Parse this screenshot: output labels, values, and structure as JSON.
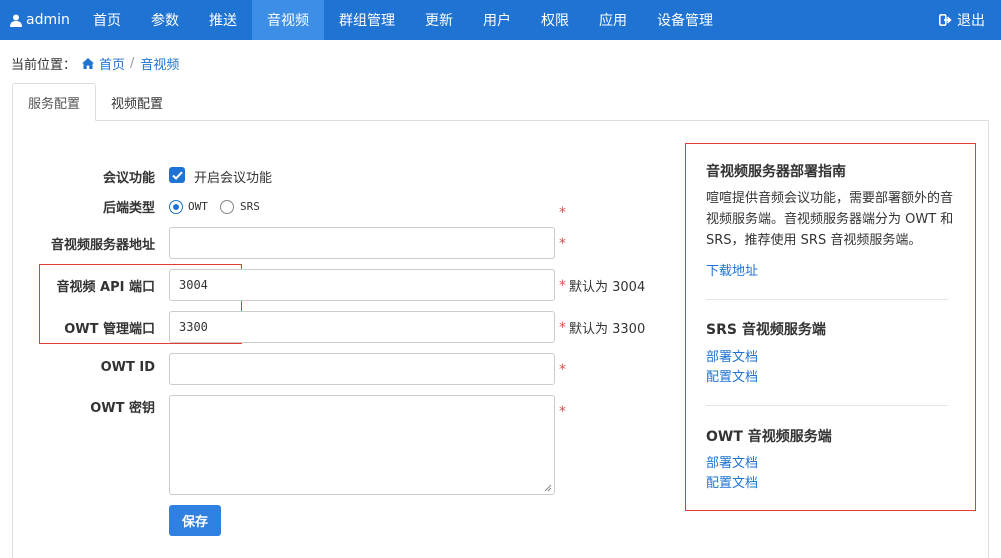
{
  "navbar": {
    "user": "admin",
    "items": [
      {
        "label": "首页",
        "active": false
      },
      {
        "label": "参数",
        "active": false
      },
      {
        "label": "推送",
        "active": false
      },
      {
        "label": "音视频",
        "active": true
      },
      {
        "label": "群组管理",
        "active": false
      },
      {
        "label": "更新",
        "active": false
      },
      {
        "label": "用户",
        "active": false
      },
      {
        "label": "权限",
        "active": false
      },
      {
        "label": "应用",
        "active": false
      },
      {
        "label": "设备管理",
        "active": false
      }
    ],
    "logout": "退出"
  },
  "breadcrumb": {
    "prefix": "当前位置：",
    "home": "首页",
    "separator": "/",
    "current": "音视频"
  },
  "tabs": [
    {
      "label": "服务配置",
      "active": true
    },
    {
      "label": "视频配置",
      "active": false
    }
  ],
  "form": {
    "meeting": {
      "label": "会议功能",
      "checkbox_label": "开启会议功能",
      "checked": true
    },
    "backend": {
      "label": "后端类型",
      "options": [
        "OWT",
        "SRS"
      ],
      "selected": "OWT"
    },
    "server_address": {
      "label": "音视频服务器地址",
      "value": ""
    },
    "api_port": {
      "label": "音视频 API 端口",
      "value": "3004",
      "hint": "默认为 3004"
    },
    "owt_port": {
      "label": "OWT 管理端口",
      "value": "3300",
      "hint": "默认为 3300"
    },
    "owt_id": {
      "label": "OWT ID",
      "value": ""
    },
    "owt_secret": {
      "label": "OWT 密钥",
      "value": ""
    },
    "required_mark": "*",
    "save": "保存"
  },
  "guide": {
    "title": "音视频服务器部署指南",
    "description": "喧喧提供音频会议功能，需要部署额外的音视频服务端。音视频服务器端分为 OWT 和 SRS，推荐使用 SRS 音视频服务端。",
    "download": "下载地址",
    "srs": {
      "title": "SRS 音视频服务端",
      "deploy_doc": "部署文档",
      "config_doc": "配置文档"
    },
    "owt": {
      "title": "OWT 音视频服务端",
      "deploy_doc": "部署文档",
      "config_doc": "配置文档"
    }
  },
  "colors": {
    "navbar": "#1f73d3",
    "nav_active": "#3c8ee6",
    "link": "#1f73d3",
    "required": "#d9534f",
    "highlight_box": "#e53935"
  }
}
